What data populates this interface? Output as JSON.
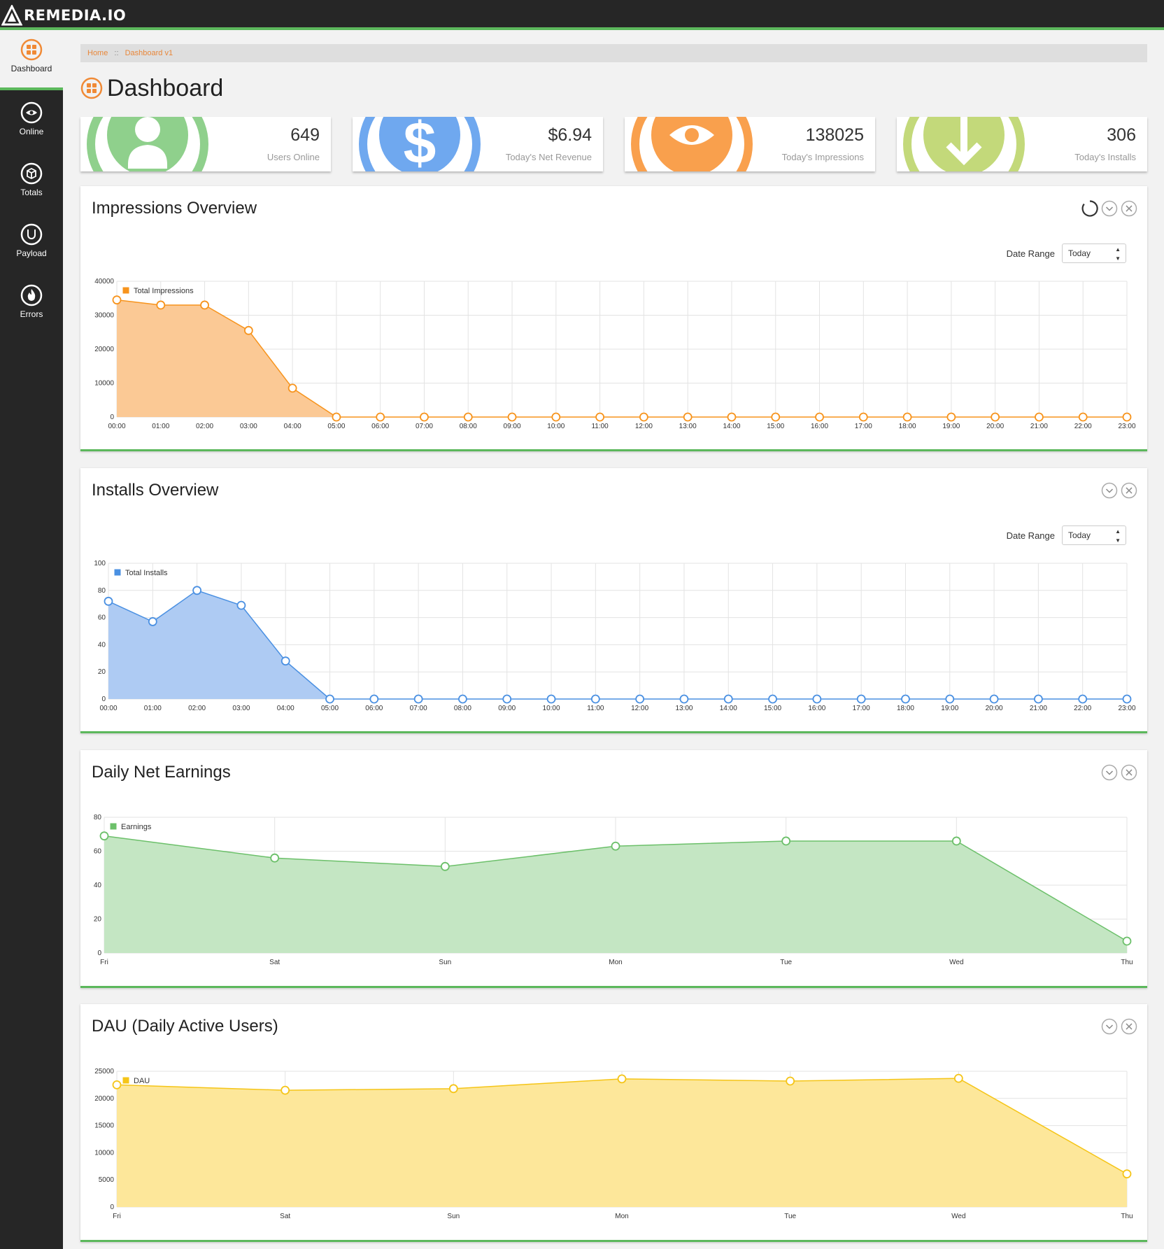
{
  "app": {
    "logo_text": "REMEDIA.IO"
  },
  "sidebar": {
    "items": [
      {
        "label": "Dashboard",
        "icon": "grid-icon",
        "active": true
      },
      {
        "label": "Online",
        "icon": "eye-icon"
      },
      {
        "label": "Totals",
        "icon": "box-icon"
      },
      {
        "label": "Payload",
        "icon": "magnet-icon"
      },
      {
        "label": "Errors",
        "icon": "fire-icon"
      }
    ]
  },
  "breadcrumb": {
    "home": "Home",
    "separator": "::",
    "current": "Dashboard v1"
  },
  "page": {
    "title": "Dashboard"
  },
  "stats": [
    {
      "value": "649",
      "label": "Users Online",
      "icon": "user-icon",
      "color": "#8fd08c"
    },
    {
      "value": "$6.94",
      "label": "Today's Net Revenue",
      "icon": "dollar-icon",
      "color": "#6fa8ef"
    },
    {
      "value": "138025",
      "label": "Today's Impressions",
      "icon": "eye-icon",
      "color": "#f9a04d"
    },
    {
      "value": "306",
      "label": "Today's Installs",
      "icon": "download-arrow-icon",
      "color": "#c3d97a"
    }
  ],
  "colors": {
    "accent_green": "#5cb85c",
    "breadcrumb_orange": "#e8873a",
    "impressions": "#f7941d",
    "installs": "#4a90e2",
    "earnings": "#6cc06a",
    "dau": "#f5c518"
  },
  "panels": {
    "impressions": {
      "title": "Impressions Overview",
      "range_label": "Date Range",
      "range_value": "Today"
    },
    "installs": {
      "title": "Installs Overview",
      "range_label": "Date Range",
      "range_value": "Today"
    },
    "earnings": {
      "title": "Daily Net Earnings"
    },
    "dau": {
      "title": "DAU (Daily Active Users)"
    }
  },
  "chart_data": [
    {
      "type": "area",
      "title": "Impressions Overview",
      "categories": [
        "00:00",
        "01:00",
        "02:00",
        "03:00",
        "04:00",
        "05:00",
        "06:00",
        "07:00",
        "08:00",
        "09:00",
        "10:00",
        "11:00",
        "12:00",
        "13:00",
        "14:00",
        "15:00",
        "16:00",
        "17:00",
        "18:00",
        "19:00",
        "20:00",
        "21:00",
        "22:00",
        "23:00"
      ],
      "series": [
        {
          "name": "Total Impressions",
          "values": [
            34500,
            33000,
            33000,
            25500,
            8500,
            0,
            0,
            0,
            0,
            0,
            0,
            0,
            0,
            0,
            0,
            0,
            0,
            0,
            0,
            0,
            0,
            0,
            0,
            0
          ]
        }
      ],
      "ylim": [
        0,
        40000
      ],
      "yticks": [
        "0",
        "10000",
        "20000",
        "30000",
        "40000"
      ],
      "grid": true,
      "legend": "top-left"
    },
    {
      "type": "area",
      "title": "Installs Overview",
      "categories": [
        "00:00",
        "01:00",
        "02:00",
        "03:00",
        "04:00",
        "05:00",
        "06:00",
        "07:00",
        "08:00",
        "09:00",
        "10:00",
        "11:00",
        "12:00",
        "13:00",
        "14:00",
        "15:00",
        "16:00",
        "17:00",
        "18:00",
        "19:00",
        "20:00",
        "21:00",
        "22:00",
        "23:00"
      ],
      "series": [
        {
          "name": "Total Installs",
          "values": [
            72,
            57,
            80,
            69,
            28,
            0,
            0,
            0,
            0,
            0,
            0,
            0,
            0,
            0,
            0,
            0,
            0,
            0,
            0,
            0,
            0,
            0,
            0,
            0
          ]
        }
      ],
      "ylim": [
        0,
        100
      ],
      "yticks": [
        "0",
        "20",
        "40",
        "60",
        "80",
        "100"
      ],
      "grid": true,
      "legend": "top-left"
    },
    {
      "type": "area",
      "title": "Daily Net Earnings",
      "categories": [
        "Fri",
        "Sat",
        "Sun",
        "Mon",
        "Tue",
        "Wed",
        "Thu"
      ],
      "series": [
        {
          "name": "Earnings",
          "values": [
            69,
            56,
            51,
            63,
            66,
            66,
            7
          ]
        }
      ],
      "ylim": [
        0,
        80
      ],
      "yticks": [
        "0",
        "20",
        "40",
        "60",
        "80"
      ],
      "grid": true,
      "legend": "top-left"
    },
    {
      "type": "area",
      "title": "DAU (Daily Active Users)",
      "categories": [
        "Fri",
        "Sat",
        "Sun",
        "Mon",
        "Tue",
        "Wed",
        "Thu"
      ],
      "series": [
        {
          "name": "DAU",
          "values": [
            22500,
            21500,
            21800,
            23600,
            23200,
            23700,
            6100
          ]
        }
      ],
      "ylim": [
        0,
        25000
      ],
      "yticks": [
        "0",
        "5000",
        "10000",
        "15000",
        "20000",
        "25000"
      ],
      "grid": true,
      "legend": "top-left"
    }
  ]
}
